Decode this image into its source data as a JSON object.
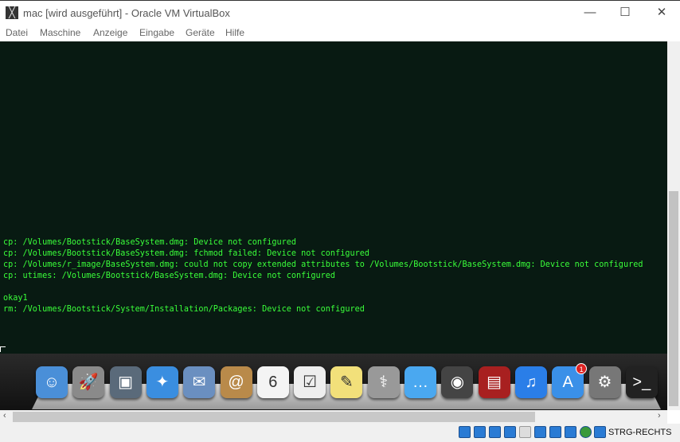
{
  "window": {
    "title": "mac [wird ausgeführt] - Oracle VM VirtualBox",
    "minimize": "—",
    "maximize": "☐",
    "close": "✕"
  },
  "menu": [
    "Datei",
    "Maschine",
    "Anzeige",
    "Eingabe",
    "Geräte",
    "Hilfe"
  ],
  "terminal": {
    "lines": [
      "cp: /Volumes/Bootstick/BaseSystem.dmg: Device not configured",
      "cp: /Volumes/Bootstick/BaseSystem.dmg: fchmod failed: Device not configured",
      "cp: /Volumes/r_image/BaseSystem.dmg: could not copy extended attributes to /Volumes/Bootstick/BaseSystem.dmg: Device not configured",
      "cp: utimes: /Volumes/Bootstick/BaseSystem.dmg: Device not configured",
      "",
      "okay1",
      "rm: /Volumes/Bootstick/System/Installation/Packages: Device not configured"
    ]
  },
  "dock": {
    "items": [
      {
        "name": "finder",
        "color": "#4a8fd8",
        "glyph": "☺"
      },
      {
        "name": "launchpad",
        "color": "#8a8a8a",
        "glyph": "🚀"
      },
      {
        "name": "iphoto",
        "color": "#5a6a7a",
        "glyph": "▣"
      },
      {
        "name": "safari",
        "color": "#3a8ee0",
        "glyph": "✦"
      },
      {
        "name": "mail",
        "color": "#6a8fc0",
        "glyph": "✉"
      },
      {
        "name": "contacts",
        "color": "#b98a4a",
        "glyph": "@"
      },
      {
        "name": "calendar",
        "color": "#f4f4f4",
        "glyph": "6"
      },
      {
        "name": "reminders",
        "color": "#eee",
        "glyph": "☑"
      },
      {
        "name": "notes",
        "color": "#f2e07a",
        "glyph": "✎"
      },
      {
        "name": "disk-utility",
        "color": "#999",
        "glyph": "⚕"
      },
      {
        "name": "messages",
        "color": "#4aa8f0",
        "glyph": "…"
      },
      {
        "name": "facetime",
        "color": "#444",
        "glyph": "◉"
      },
      {
        "name": "photo-booth",
        "color": "#a82020",
        "glyph": "▤"
      },
      {
        "name": "itunes",
        "color": "#2a7ee8",
        "glyph": "♫"
      },
      {
        "name": "app-store",
        "color": "#3a90e8",
        "glyph": "A",
        "badge": "1"
      },
      {
        "name": "system-preferences",
        "color": "#777",
        "glyph": "⚙"
      },
      {
        "name": "terminal",
        "color": "#222",
        "glyph": ">_"
      }
    ]
  },
  "statusbar": {
    "host_key": "STRG-RECHTS"
  }
}
